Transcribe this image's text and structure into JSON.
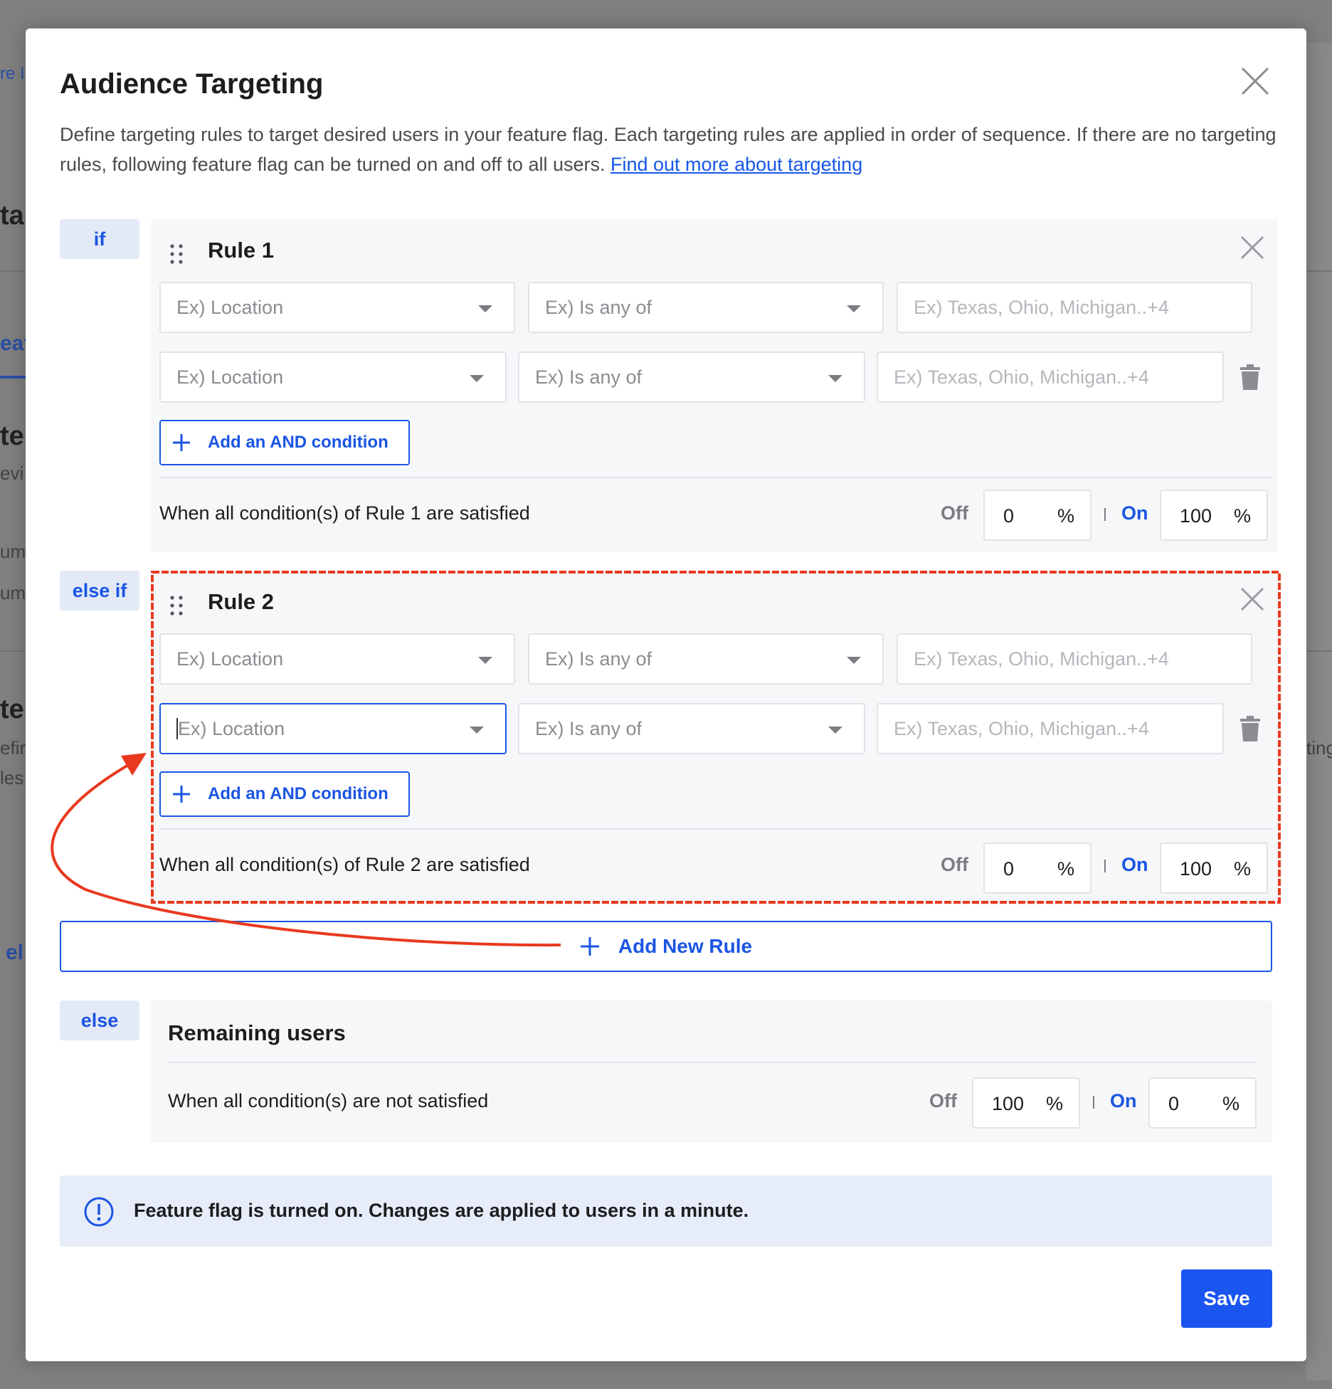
{
  "background": {
    "fragments": [
      "re I",
      "ta",
      "eat",
      "te",
      "evi",
      "umb",
      "umb",
      "te",
      "efir",
      "les",
      "el",
      "ting"
    ]
  },
  "modal": {
    "title": "Audience Targeting",
    "description": "Define targeting rules to target desired users in your feature flag. Each targeting rules are applied in order of sequence. If there are no targeting rules, following feature flag can be turned on and off to all users.",
    "learn_more": "Find out more about targeting",
    "close_icon": "close-icon"
  },
  "rules": [
    {
      "tag": "if",
      "title": "Rule 1",
      "conditions": [
        {
          "attribute": "Ex) Location",
          "operator": "Ex) Is any of",
          "value_placeholder": "Ex) Texas, Ohio, Michigan..+4"
        },
        {
          "attribute": "Ex) Location",
          "operator": "Ex) Is any of",
          "value_placeholder": "Ex) Texas, Ohio, Michigan..+4"
        }
      ],
      "add_condition": "Add an AND condition",
      "satisfied_text": "When all condition(s) of Rule 1 are satisfied",
      "off_label": "Off",
      "off_value": "0",
      "on_label": "On",
      "on_value": "100",
      "percent_symbol": "%"
    },
    {
      "tag": "else if",
      "title": "Rule 2",
      "conditions": [
        {
          "attribute": "Ex) Location",
          "operator": "Ex) Is any of",
          "value_placeholder": "Ex) Texas, Ohio, Michigan..+4"
        },
        {
          "attribute": "Ex) Location",
          "operator": "Ex) Is any of",
          "value_placeholder": "Ex) Texas, Ohio, Michigan..+4"
        }
      ],
      "add_condition": "Add an AND condition",
      "satisfied_text": "When all condition(s) of Rule 2 are satisfied",
      "off_label": "Off",
      "off_value": "0",
      "on_label": "On",
      "on_value": "100",
      "percent_symbol": "%"
    }
  ],
  "add_new_rule": "Add New Rule",
  "else_block": {
    "tag": "else",
    "title": "Remaining users",
    "satisfied_text": "When all condition(s) are not satisfied",
    "off_label": "Off",
    "off_value": "100",
    "on_label": "On",
    "on_value": "0",
    "percent_symbol": "%"
  },
  "info": {
    "icon": "info-circle-icon",
    "text": "Feature flag is turned on. Changes are applied to users in a minute."
  },
  "save_label": "Save",
  "colors": {
    "accent": "#1a55e3",
    "annotation": "#e8391f",
    "card_bg": "#f6f7f9",
    "info_bg": "#e6ecf8"
  }
}
